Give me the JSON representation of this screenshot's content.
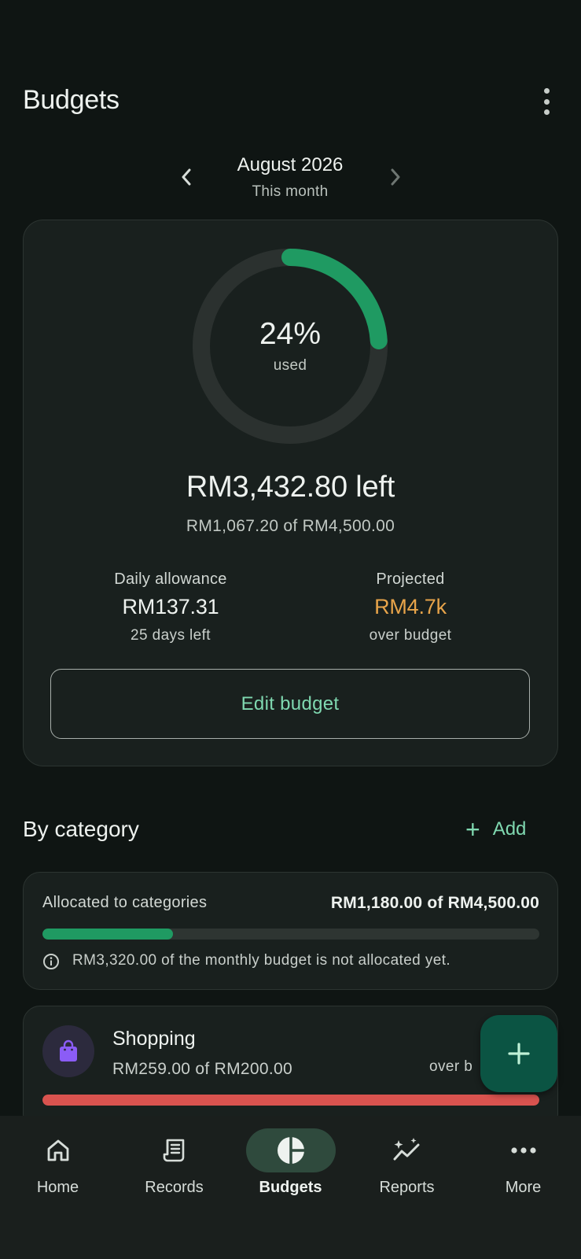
{
  "header": {
    "title": "Budgets"
  },
  "period": {
    "month": "August 2026",
    "subtitle": "This month"
  },
  "summary": {
    "percent_used": 24,
    "percent_text": "24%",
    "used_label": "used",
    "left_text": "RM3,432.80 left",
    "of_text": "RM1,067.20 of RM4,500.00",
    "daily_allowance": {
      "label": "Daily allowance",
      "value": "RM137.31",
      "sub": "25 days left"
    },
    "projected": {
      "label": "Projected",
      "value": "RM4.7k",
      "sub": "over budget"
    },
    "edit_label": "Edit budget"
  },
  "categories": {
    "title": "By category",
    "add_label": "Add",
    "allocation": {
      "label": "Allocated to categories",
      "amount": "RM1,180.00 of RM4,500.00",
      "fraction": 0.262,
      "note": "RM3,320.00 of the monthly budget is not allocated yet."
    },
    "items": [
      {
        "name": "Shopping",
        "amount": "RM259.00 of RM200.00",
        "status": "over b",
        "fraction": 1.0
      }
    ]
  },
  "nav": {
    "items": [
      {
        "label": "Home"
      },
      {
        "label": "Records"
      },
      {
        "label": "Budgets"
      },
      {
        "label": "Reports"
      },
      {
        "label": "More"
      }
    ],
    "active_index": 2
  },
  "colors": {
    "accent": "#7fd8b0",
    "progress_green": "#1f9a62",
    "over_red": "#d9534f",
    "projected_orange": "#e8a44a",
    "shopping_purple": "#8b5cf6"
  }
}
